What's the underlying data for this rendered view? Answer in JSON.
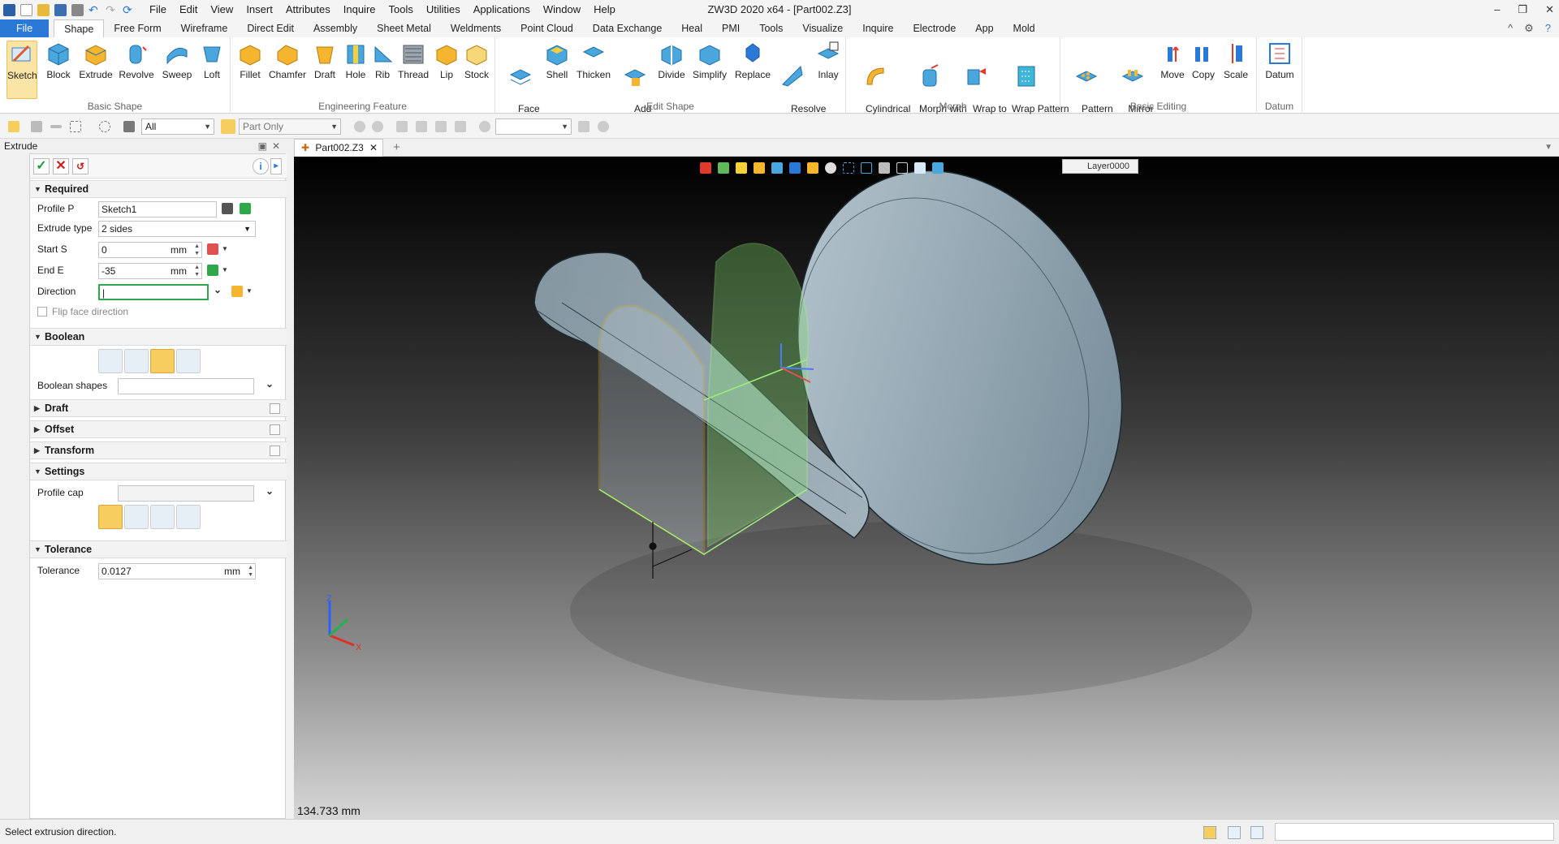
{
  "app": {
    "title": "ZW3D 2020 x64 - [Part002.Z3]"
  },
  "menubar": [
    "File",
    "Edit",
    "View",
    "Insert",
    "Attributes",
    "Inquire",
    "Tools",
    "Utilities",
    "Applications",
    "Window",
    "Help"
  ],
  "ribbon_tabs": [
    "File",
    "Shape",
    "Free Form",
    "Wireframe",
    "Direct Edit",
    "Assembly",
    "Sheet Metal",
    "Weldments",
    "Point Cloud",
    "Data Exchange",
    "Heal",
    "PMI",
    "Tools",
    "Visualize",
    "Inquire",
    "Electrode",
    "App",
    "Mold"
  ],
  "ribbon_groups": {
    "basic_shape": {
      "label": "Basic Shape",
      "buttons": [
        "Sketch",
        "Block",
        "Extrude",
        "Revolve",
        "Sweep",
        "Loft"
      ]
    },
    "engineering_feature": {
      "label": "Engineering Feature",
      "buttons": [
        "Fillet",
        "Chamfer",
        "Draft",
        "Hole",
        "Rib",
        "Thread",
        "Lip",
        "Stock"
      ]
    },
    "edit_shape": {
      "label": "Edit Shape",
      "buttons": [
        "Face\nOffset",
        "Shell",
        "Thicken",
        "Add\nShape",
        "Divide",
        "Simplify",
        "Replace",
        "Resolve\nSelfX",
        "Inlay"
      ]
    },
    "morph": {
      "label": "Morph",
      "buttons": [
        "Cylindrical\nBend",
        "Morph with\nPoint",
        "Wrap to\nFaces",
        "Wrap Pattern\nto Faces"
      ]
    },
    "basic_editing": {
      "label": "Basic Editing",
      "buttons": [
        "Pattern\nFeature",
        "Mirror\nFeature",
        "Move",
        "Copy",
        "Scale"
      ]
    },
    "datum": {
      "label": "Datum",
      "buttons": [
        "Datum"
      ]
    }
  },
  "toolbar": {
    "filter": "All",
    "scope": "Part Only"
  },
  "panel": {
    "title": "Extrude",
    "sections": {
      "required": "Required",
      "boolean": "Boolean",
      "draft": "Draft",
      "offset": "Offset",
      "transform": "Transform",
      "settings": "Settings",
      "tolerance": "Tolerance"
    },
    "fields": {
      "profile_label": "Profile P",
      "profile_value": "Sketch1",
      "type_label": "Extrude type",
      "type_value": "2 sides",
      "start_label": "Start S",
      "start_value": "0",
      "start_unit": "mm",
      "end_label": "End E",
      "end_value": "-35",
      "end_unit": "mm",
      "direction_label": "Direction",
      "direction_value": "",
      "flip_label": "Flip face direction",
      "boolean_shapes_label": "Boolean shapes",
      "profile_cap_label": "Profile cap",
      "tolerance_label": "Tolerance",
      "tolerance_value": "0.0127",
      "tolerance_unit": "mm"
    }
  },
  "doc": {
    "tab": "Part002.Z3"
  },
  "viewport": {
    "layer": "Layer0000",
    "measure": "134.733 mm"
  },
  "status": {
    "text": "Select extrusion direction."
  },
  "colors": {
    "accent": "#2b79d6",
    "highlight": "#f7cd5e",
    "part": "#9fb2bd",
    "sketch": "#f2b51f",
    "preview": "#9cf07a"
  }
}
